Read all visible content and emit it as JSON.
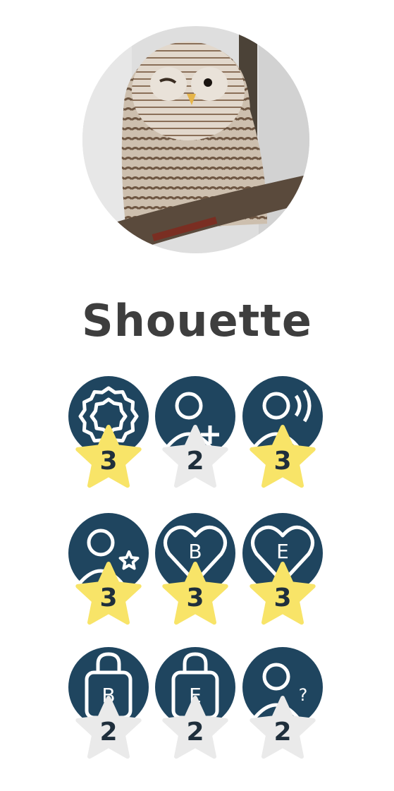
{
  "profile": {
    "name": "Shouette",
    "avatar": "owl-photo"
  },
  "colors": {
    "badge_bg": "#1f455f",
    "star_gold": "#f8e468",
    "star_gray": "#eaeaea"
  },
  "badges": [
    {
      "icon": "flower-badge-icon",
      "count": "3",
      "level": "gold"
    },
    {
      "icon": "add-user-icon",
      "count": "2",
      "level": "silver"
    },
    {
      "icon": "user-speaking-icon",
      "count": "3",
      "level": "gold"
    },
    {
      "icon": "user-star-icon",
      "count": "3",
      "level": "gold"
    },
    {
      "icon": "heart-letter-icon",
      "letter": "B",
      "count": "3",
      "level": "gold"
    },
    {
      "icon": "heart-letter-icon",
      "letter": "E",
      "count": "3",
      "level": "gold"
    },
    {
      "icon": "lock-letter-icon",
      "letter": "B",
      "count": "2",
      "level": "silver"
    },
    {
      "icon": "lock-letter-icon",
      "letter": "E",
      "count": "2",
      "level": "silver"
    },
    {
      "icon": "user-question-icon",
      "count": "2",
      "level": "silver"
    }
  ]
}
